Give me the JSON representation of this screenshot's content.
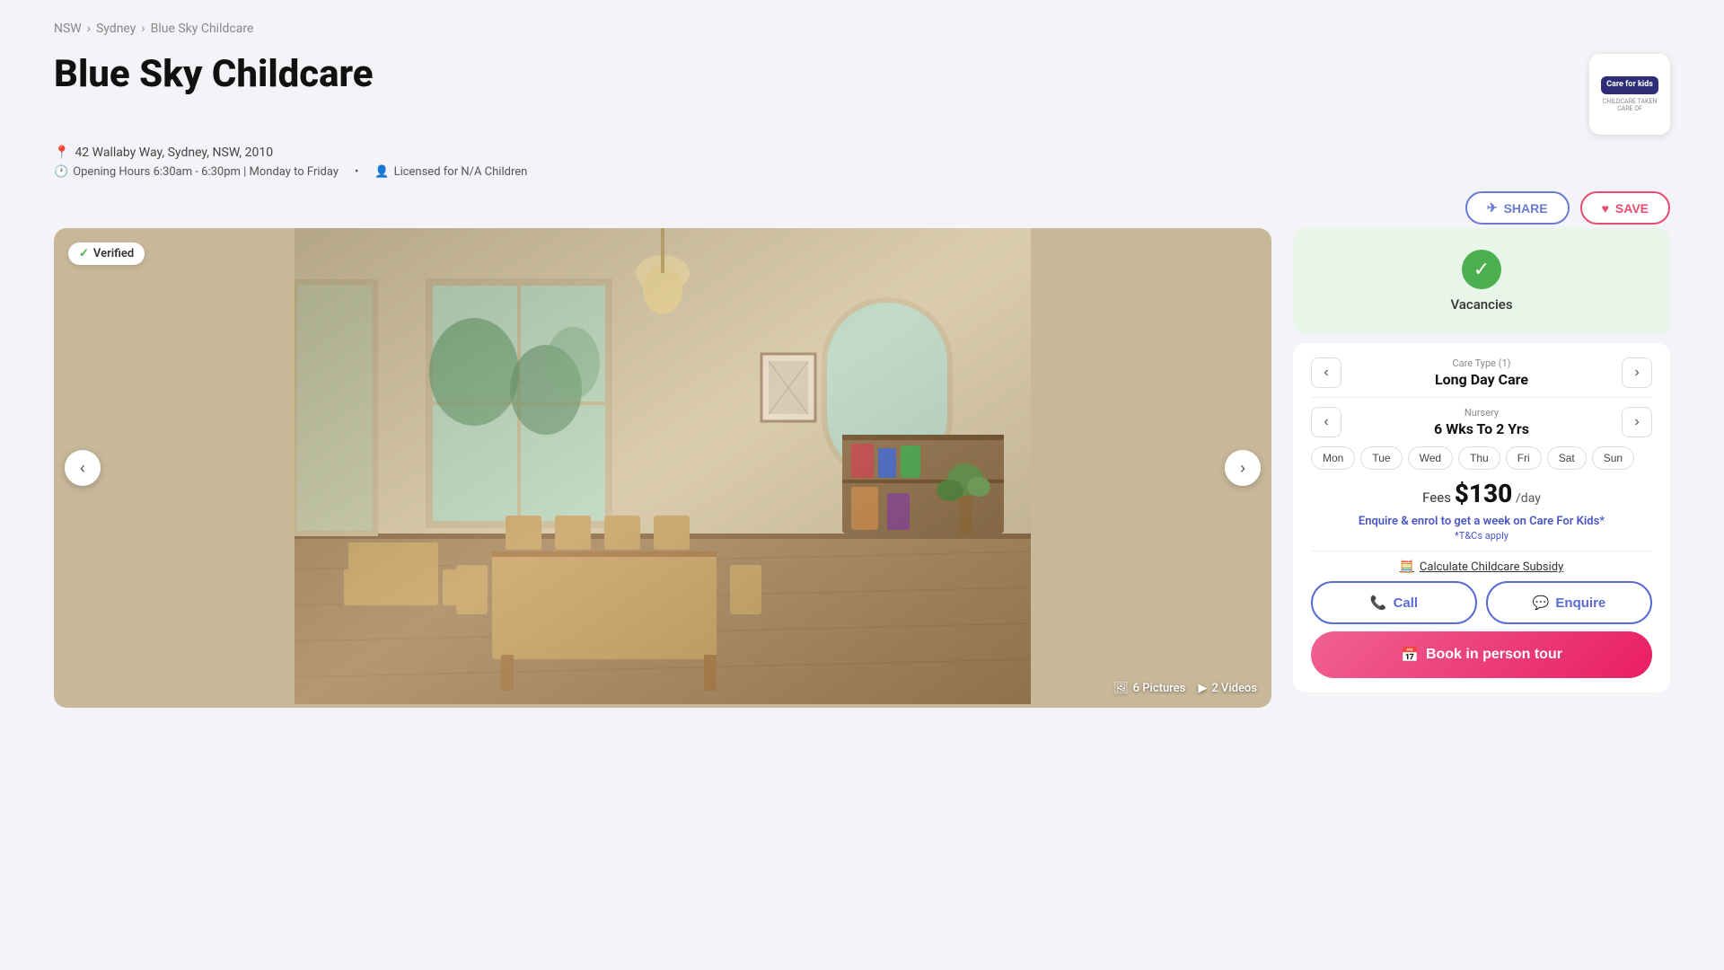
{
  "breadcrumb": {
    "items": [
      "NSW",
      "Sydney",
      "Blue Sky Childcare"
    ]
  },
  "header": {
    "title": "Blue Sky Childcare",
    "logo_text": "Care for kids",
    "logo_sub": "CHILDCARE TAKEN CARE OF"
  },
  "meta": {
    "address": "42 Wallaby Way, Sydney, NSW, 2010",
    "opening_hours": "Opening Hours 6:30am - 6:30pm | Monday to Friday",
    "licensed": "Licensed for N/A Children"
  },
  "actions": {
    "share_label": "SHARE",
    "save_label": "SAVE"
  },
  "image": {
    "verified_label": "Verified",
    "pictures_count": "6 Pictures",
    "videos_count": "2 Videos"
  },
  "vacancies": {
    "label": "Vacancies"
  },
  "care_type": {
    "label": "Care Type (1)",
    "value": "Long Day Care"
  },
  "nursery": {
    "label": "Nursery",
    "value": "6 Wks To 2 Yrs"
  },
  "days": [
    {
      "label": "Mon",
      "active": false
    },
    {
      "label": "Tue",
      "active": false
    },
    {
      "label": "Wed",
      "active": false
    },
    {
      "label": "Thu",
      "active": false
    },
    {
      "label": "Fri",
      "active": false
    },
    {
      "label": "Sat",
      "active": false
    },
    {
      "label": "Sun",
      "active": false
    }
  ],
  "fees": {
    "label": "Fees",
    "amount": "$130",
    "per": "/day"
  },
  "promo": {
    "text": "Enquire & enrol to get a week on Care For Kids*",
    "tc": "*T&Cs apply"
  },
  "calculate": {
    "label": "Calculate Childcare Subsidy"
  },
  "buttons": {
    "call": "Call",
    "enquire": "Enquire",
    "book": "Book in person tour"
  }
}
